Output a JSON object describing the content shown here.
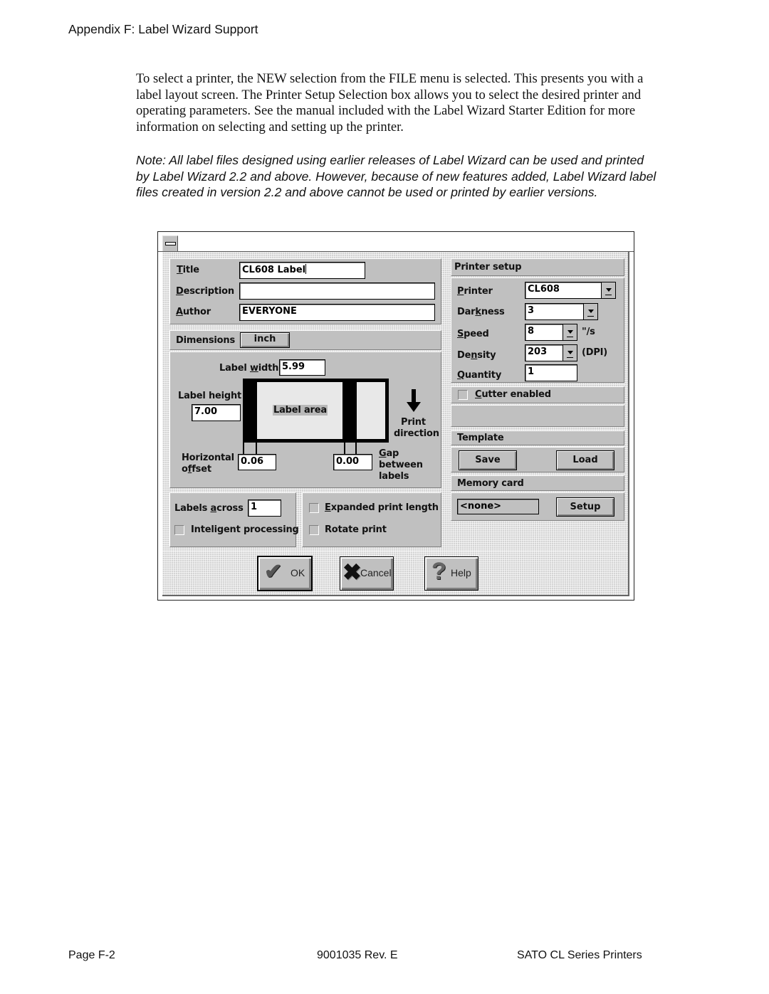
{
  "page": {
    "running_head": "Appendix F: Label Wizard Support",
    "paragraph": "To select a printer, the NEW selection from the FILE menu is selected. This presents you with a label layout screen. The Printer Setup Selection box allows you to select the desired printer and operating parameters. See the manual included with the Label Wizard Starter Edition for more information on selecting and setting up the printer.",
    "note": "Note: All label files designed using earlier releases of Label Wizard can be used and printed by Label Wizard 2.2 and above. However, because of new features added, Label Wizard label files created in version 2.2 and above cannot be used or printed by earlier versions.",
    "footer": {
      "left": "Page F-2",
      "center": "9001035 Rev. E",
      "right": "SATO CL Series Printers"
    }
  },
  "dialog": {
    "title_fields": {
      "title_label": "Title",
      "title_value": "CL608 Label",
      "description_label": "Description",
      "description_value": "",
      "author_label": "Author",
      "author_value": "EVERYONE"
    },
    "dimensions": {
      "label": "Dimensions",
      "unit_button": "inch"
    },
    "layout": {
      "label_width_label": "Label width",
      "label_width_value": "5.99",
      "label_height_label": "Label height",
      "label_height_value": "7.00",
      "label_area_text": "Label area",
      "print_direction_line1": "Print",
      "print_direction_line2": "direction",
      "horizontal_offset_line1": "Horizontal",
      "horizontal_offset_line2": "offset",
      "horizontal_offset_value": "0.06",
      "gap_value": "0.00",
      "gap_line1": "Gap",
      "gap_line2": "between",
      "gap_line3": "labels"
    },
    "options": {
      "labels_across_label": "Labels across",
      "labels_across_value": "1",
      "intelligent_processing": "Inteligent processing",
      "intelligent_processing_checked": false,
      "expanded_print_length": "Expanded print length",
      "expanded_print_length_checked": false,
      "rotate_print": "Rotate print",
      "rotate_print_checked": false
    },
    "printer_setup": {
      "header": "Printer setup",
      "printer_label": "Printer",
      "printer_value": "CL608",
      "darkness_label": "Darkness",
      "darkness_value": "3",
      "speed_label": "Speed",
      "speed_value": "8",
      "speed_unit": "\"/s",
      "density_label": "Density",
      "density_value": "203",
      "density_unit": "(DPI)",
      "quantity_label": "Quantity",
      "quantity_value": "1"
    },
    "cutter": {
      "label": "Cutter enabled",
      "checked": false
    },
    "template": {
      "header": "Template",
      "save": "Save",
      "load": "Load"
    },
    "memory_card": {
      "header": "Memory card",
      "value": "<none>",
      "setup": "Setup"
    },
    "buttons": {
      "ok": "OK",
      "cancel": "Cancel",
      "help": "Help"
    }
  }
}
